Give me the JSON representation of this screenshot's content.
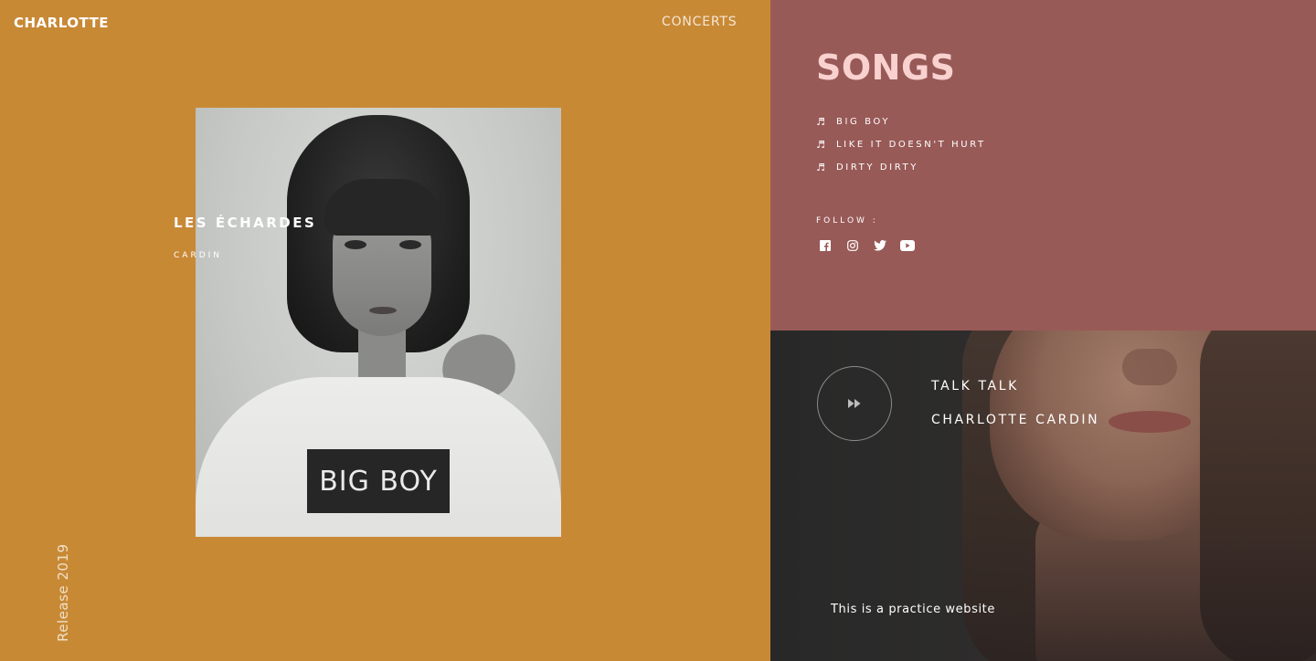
{
  "header": {
    "brand": "CHARLOTTE",
    "nav_concerts": "CONCERTS"
  },
  "album": {
    "title": "LES ÉCHARDES",
    "artist": "CARDIN",
    "shirt_text": "BIG BOY",
    "release_label": "Release 2019"
  },
  "songs": {
    "heading": "SONGS",
    "items": [
      {
        "label": "BIG BOY",
        "icon": "music-note-icon"
      },
      {
        "label": "LIKE IT DOESN'T HURT",
        "icon": "music-note-icon"
      },
      {
        "label": "DIRTY DIRTY",
        "icon": "music-note-icon"
      }
    ],
    "follow_label": "FOLLOW :",
    "social": [
      "facebook-icon",
      "instagram-icon",
      "twitter-icon",
      "youtube-icon"
    ]
  },
  "player": {
    "button_icon": "fast-forward-icon",
    "track_title": "TALK TALK",
    "track_artist": "CHARLOTTE CARDIN",
    "footnote": "This is a practice website"
  },
  "colors": {
    "left_panel": "#c88935",
    "right_top_panel": "#985a57",
    "songs_heading": "#f9d2d0",
    "right_bottom_panel": "#2a2a2a"
  }
}
